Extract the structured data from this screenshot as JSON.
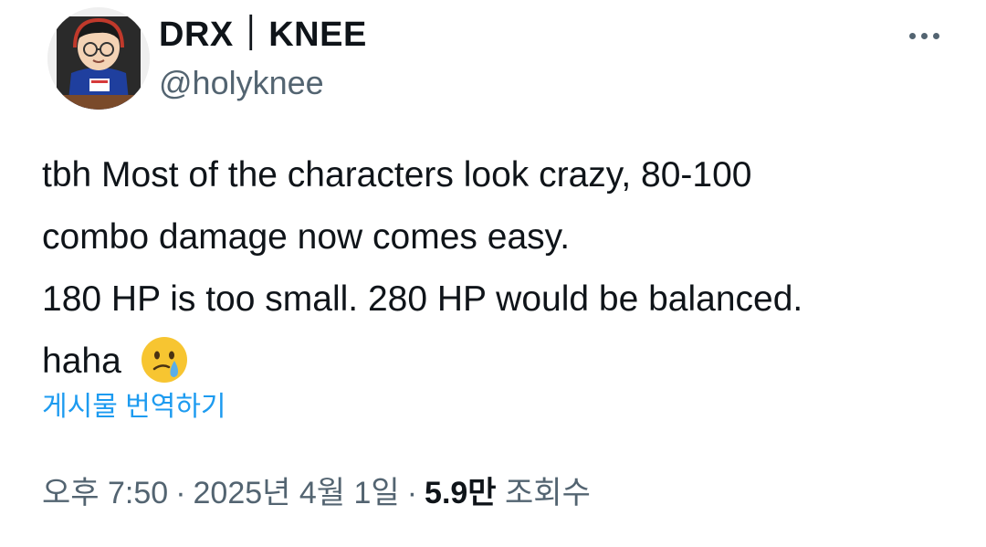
{
  "author": {
    "display_name": "DRX｜KNEE",
    "handle": "@holyknee"
  },
  "tweet": {
    "lines": [
      "tbh Most of the characters look crazy, 80-100",
      "combo damage now comes easy.",
      "180 HP is too small. 280 HP would be balanced.",
      "haha"
    ],
    "emoji": "face-holding-back-tears-icon"
  },
  "translate_label": "게시물 번역하기",
  "meta": {
    "time": "오후 7:50",
    "separator": "·",
    "date": "2025년 4월 1일",
    "views_count": "5.9만",
    "views_label": "조회수"
  },
  "colors": {
    "text_primary": "#0f1419",
    "text_secondary": "#536471",
    "link": "#1d9bf0"
  }
}
